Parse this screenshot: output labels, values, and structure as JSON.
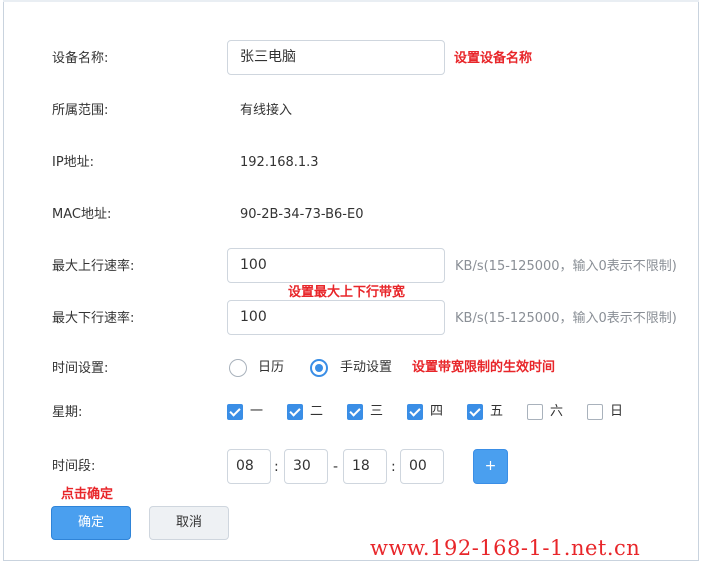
{
  "form": {
    "device_name": {
      "label": "设备名称:",
      "value": "张三电脑",
      "annotation": "设置设备名称"
    },
    "scope": {
      "label": "所属范围:",
      "value": "有线接入"
    },
    "ip": {
      "label": "IP地址:",
      "value": "192.168.1.3"
    },
    "mac": {
      "label": "MAC地址:",
      "value": "90-2B-34-73-B6-E0"
    },
    "max_up": {
      "label": "最大上行速率:",
      "value": "100",
      "hint": "KB/s(15-125000，输入0表示不限制)"
    },
    "bandwidth_annotation": "设置最大上下行带宽",
    "max_down": {
      "label": "最大下行速率:",
      "value": "100",
      "hint": "KB/s(15-125000，输入0表示不限制)"
    },
    "time_setting": {
      "label": "时间设置:",
      "options": [
        {
          "label": "日历",
          "selected": false
        },
        {
          "label": "手动设置",
          "selected": true
        }
      ],
      "annotation": "设置带宽限制的生效时间"
    },
    "week": {
      "label": "星期:",
      "days": [
        {
          "label": "一",
          "checked": true
        },
        {
          "label": "二",
          "checked": true
        },
        {
          "label": "三",
          "checked": true
        },
        {
          "label": "四",
          "checked": true
        },
        {
          "label": "五",
          "checked": true
        },
        {
          "label": "六",
          "checked": false
        },
        {
          "label": "日",
          "checked": false
        }
      ]
    },
    "time_range": {
      "label": "时间段:",
      "start_hour": "08",
      "start_min": "30",
      "end_hour": "18",
      "end_min": "00",
      "sep_colon": ":",
      "sep_dash": "-",
      "add_label": "+"
    }
  },
  "actions": {
    "confirm_annotation": "点击确定",
    "confirm_label": "确定",
    "cancel_label": "取消"
  },
  "watermark": "www.192-168-1-1.net.cn",
  "colors": {
    "accent": "#3a8ee6",
    "annotation": "#e8262a"
  }
}
